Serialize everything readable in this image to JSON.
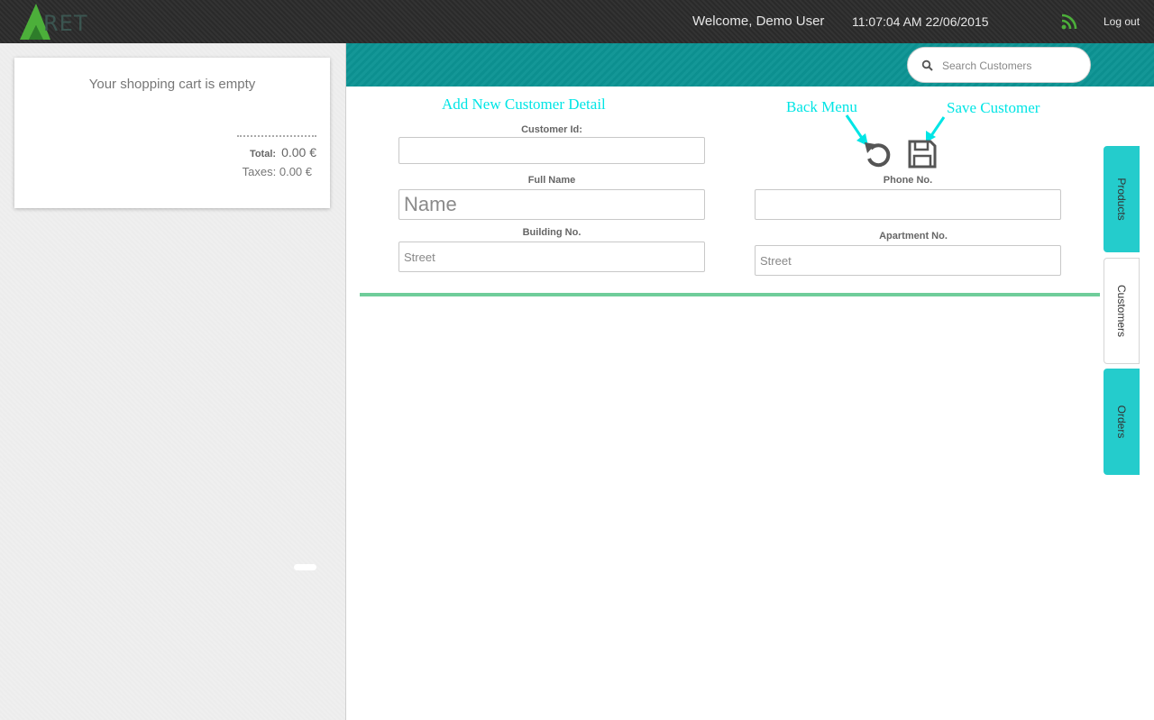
{
  "header": {
    "logo_text": "RET",
    "welcome": "Welcome, Demo User",
    "datetime": "11:07:04 AM 22/06/2015",
    "logout_label": "Log out",
    "rss_icon": "rss-icon",
    "accent_color": "#4caf3a"
  },
  "cart": {
    "empty_message": "Your shopping cart is empty",
    "total_label": "Total:",
    "total_value": "0.00 €",
    "taxes_text": "Taxes: 0.00 €"
  },
  "search": {
    "placeholder": "Search Customers",
    "icon": "search-icon"
  },
  "form": {
    "annotation_title": "Add New Customer Detail",
    "annotation_back": "Back Menu",
    "annotation_save": "Save Customer",
    "customer_id_label": "Customer Id:",
    "customer_id_value": "",
    "full_name_label": "Full Name",
    "full_name_placeholder": "Name",
    "building_label": "Building No.",
    "building_placeholder": "Street",
    "phone_label": "Phone No.",
    "phone_value": "",
    "apartment_label": "Apartment No.",
    "apartment_placeholder": "Street",
    "back_icon": "undo-icon",
    "save_icon": "floppy-disk-icon"
  },
  "tabs": [
    {
      "label": "Products",
      "color": "#24cccc"
    },
    {
      "label": "Customers",
      "color": "#ffffff"
    },
    {
      "label": "Orders",
      "color": "#24cccc"
    }
  ],
  "colors": {
    "teal_header": "#0c9494",
    "annotation": "#00e5e5",
    "divider": "#6fcd9a"
  }
}
